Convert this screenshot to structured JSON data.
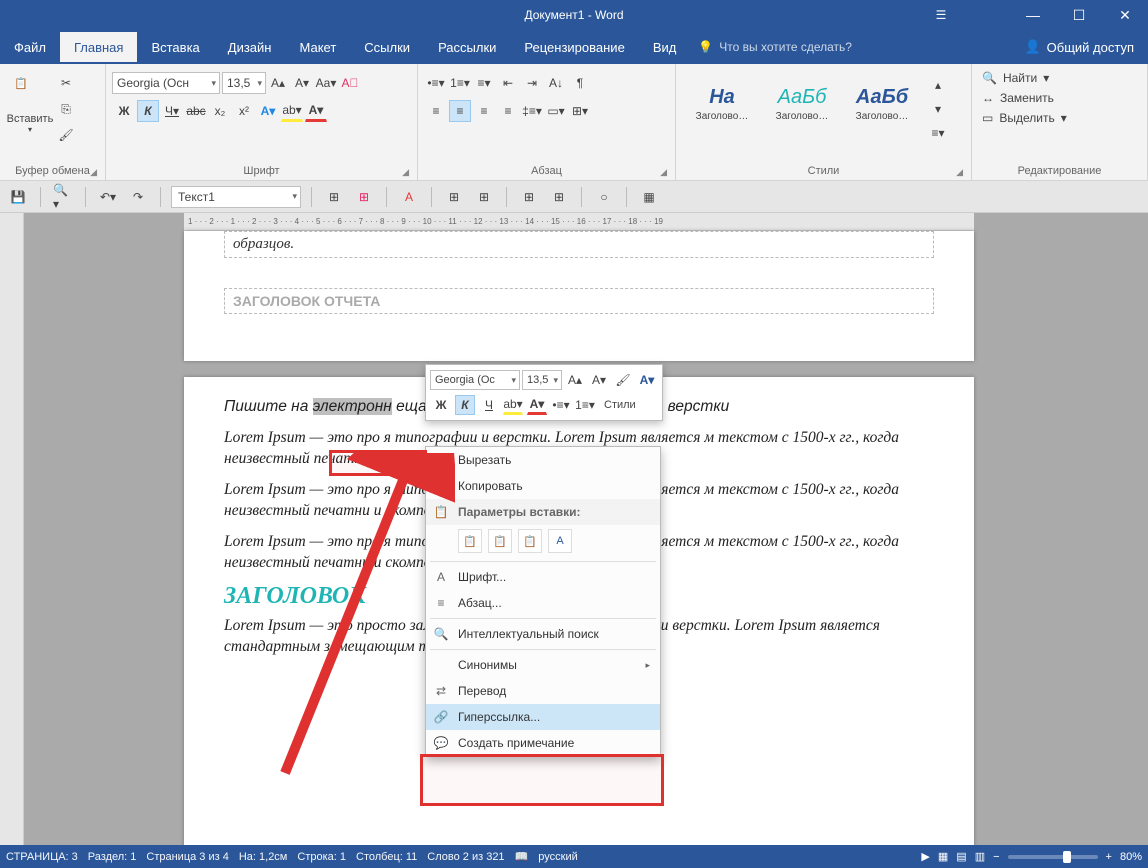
{
  "title": "Документ1 - Word",
  "menu": {
    "file": "Файл",
    "home": "Главная",
    "insert": "Вставка",
    "design": "Дизайн",
    "layout": "Макет",
    "references": "Ссылки",
    "mailings": "Рассылки",
    "review": "Рецензирование",
    "view": "Вид",
    "tellme": "Что вы хотите сделать?",
    "share": "Общий доступ"
  },
  "ribbon": {
    "paste": "Вставить",
    "clipboard": "Буфер обмена",
    "fontname": "Georgia (Осн",
    "fontsize": "13,5",
    "fontgrp": "Шрифт",
    "paragrp": "Абзац",
    "stylesgrp": "Стили",
    "styles": [
      "Заголово…",
      "Заголово…",
      "Заголово…"
    ],
    "style_prev": [
      "На",
      "АаБб",
      "АаБб"
    ],
    "editing": "Редактирование",
    "find": "Найти",
    "replace": "Заменить",
    "select": "Выделить"
  },
  "qat": {
    "stylecombo": "Текст1"
  },
  "ruler": "1 · · · 2 · · · 1 · · · 2 · · · 3 · · · 4 · · · 5 · · · 6 · · · 7 · · · 8 · · · 9 · · · 10 · · · 11 · · · 12 · · · 13 · · · 14 · · · 15 · · · 16 · · · 17 · · · 18 · · · 19",
  "doc": {
    "hdr1": "образцов.",
    "hdr2": "ЗАГОЛОВОК ОТЧЕТА",
    "p1a": "Пишите на ",
    "p1b": "электронн",
    "p1c": "                                              ещающий текст для типографии и верстки",
    "p2": "Lorem Ipsum — это про                                          я типографии и верстки. Lorem Ipsum является                                          м текстом с 1500-х гг., когда неизвестный печатни                                          и скомпоновал их в типографский катало",
    "p3": "Lorem Ipsum — это про                                          я типографии и верстки. Lorem Ipsum является                                          м текстом с 1500-х гг., когда неизвестный печатни                                          и скомпоновал их в типографский катало",
    "p4": "Lorem Ipsum — это про                                          я типографии и верстки. Lorem Ipsum является                                          м текстом с 1500-х гг., когда неизвестный печатни                                          и скомпоновал их в типографский катало",
    "h": "ЗАГОЛОВОК",
    "p5": "Lorem Ipsum — это просто замещающий текст для типографии и верстки. Lorem Ipsum является стандартным замещающим текстом с 1500-х гг., когда"
  },
  "mini": {
    "fontname": "Georgia (Ос",
    "fontsize": "13,5",
    "styles": "Стили"
  },
  "ctx": {
    "cut": "Вырезать",
    "copy": "Копировать",
    "pasteopts": "Параметры вставки:",
    "font": "Шрифт...",
    "para": "Абзац...",
    "smart": "Интеллектуальный поиск",
    "syn": "Синонимы",
    "trans": "Перевод",
    "link": "Гиперссылка...",
    "comment": "Создать примечание"
  },
  "status": {
    "page": "СТРАНИЦА: 3",
    "section": "Раздел: 1",
    "pageof": "Страница 3 из 4",
    "at": "На: 1,2см",
    "line": "Строка: 1",
    "col": "Столбец: 11",
    "words": "Слово 2 из 321",
    "lang": "русский",
    "zoom": "80%"
  }
}
